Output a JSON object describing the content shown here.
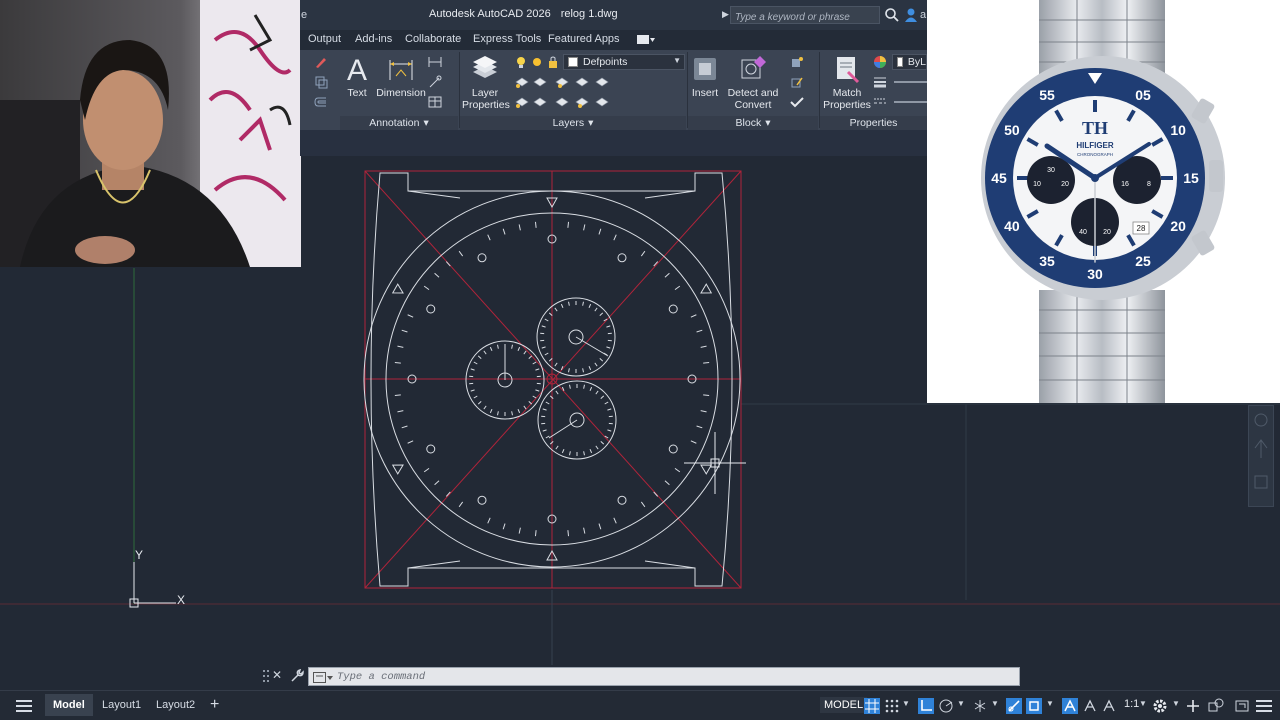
{
  "titlebar": {
    "cut_prefix": "e",
    "app_name": "Autodesk AutoCAD 2026",
    "file_name": "relog 1.dwg",
    "search_placeholder": "Type a keyword or phrase",
    "user_cut": "a"
  },
  "tabs": [
    "Output",
    "Add-ins",
    "Collaborate",
    "Express Tools",
    "Featured Apps"
  ],
  "ribbon": {
    "text_label": "Text",
    "dimension_label": "Dimension",
    "layer_properties_label": [
      "Layer",
      "Properties"
    ],
    "layer_combo": "Defpoints",
    "insert_label": "Insert",
    "detect_convert_label": [
      "Detect and",
      "Convert"
    ],
    "match_properties_label": [
      "Match",
      "Properties"
    ],
    "bylayer_cut": "ByL",
    "panels": {
      "annotation": "Annotation",
      "layers": "Layers",
      "block": "Block",
      "properties": "Properties"
    }
  },
  "drawing": {
    "ucs_x": "X",
    "ucs_y": "Y"
  },
  "reference_watch": {
    "brand": "HILFIGER",
    "subtitle": "CHRONOGRAPH",
    "logo": "TH",
    "bezel_numbers": [
      "55",
      "05",
      "10",
      "15",
      "20",
      "25",
      "30",
      "35",
      "40",
      "45",
      "50"
    ],
    "subdial_left": [
      "30",
      "10",
      "20"
    ],
    "subdial_right": [
      "16",
      "8"
    ],
    "subdial_bottom": [
      "40",
      "20"
    ],
    "date": "28"
  },
  "command_line": {
    "placeholder": "Type a command"
  },
  "statusbar": {
    "layouts": [
      "Model",
      "Layout1",
      "Layout2"
    ],
    "model_button": "MODEL",
    "scale": "1:1"
  },
  "colors": {
    "canvas": "#222935",
    "accent_blue": "#2f82d8",
    "red_construction": "#b0243a",
    "watch_navy": "#1f3d74"
  }
}
